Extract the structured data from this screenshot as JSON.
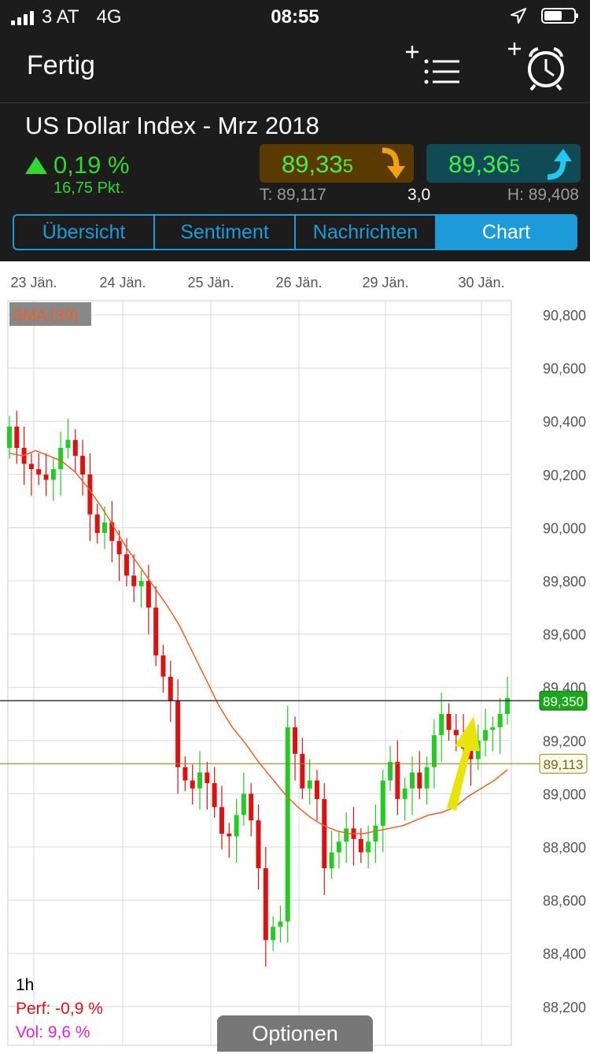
{
  "status_bar": {
    "carrier": "3 AT",
    "network": "4G",
    "time": "08:55"
  },
  "nav": {
    "done_label": "Fertig",
    "add_watchlist_icon": "plus-list-icon",
    "add_alarm_icon": "plus-alarm-icon"
  },
  "instrument": {
    "name": "US Dollar Index - Mrz 2018",
    "change_pct": "0,19 %",
    "change_points": "16,75 Pkt.",
    "bid_main": "89,33",
    "bid_small": "5",
    "ask_main": "89,36",
    "ask_small": "5",
    "low": "T: 89,117",
    "spread": "3,0",
    "high": "H: 89,408"
  },
  "tabs": [
    {
      "label": "Übersicht",
      "active": false
    },
    {
      "label": "Sentiment",
      "active": false
    },
    {
      "label": "Nachrichten",
      "active": false
    },
    {
      "label": "Chart",
      "active": true
    }
  ],
  "chart": {
    "indicator_label": "SMA (39)",
    "interval": "1h",
    "perf": "Perf: -0,9 %",
    "vol": "Vol: 9,6 %",
    "current_price_label": "89,350",
    "low_line_label": "89,113",
    "options_label": "Optionen"
  },
  "colors": {
    "up": "#22cc22",
    "down": "#dd1111",
    "sma": "#f06020",
    "accent": "#1c9bd8",
    "bid_box": "#5a3a00",
    "ask_box": "#0f4a55"
  },
  "chart_data": {
    "type": "candlestick",
    "x_ticks": [
      "23 Jän.",
      "24 Jän.",
      "25 Jän.",
      "26 Jän.",
      "29 Jän.",
      "30 Jän."
    ],
    "y_ticks": [
      "90,800",
      "90,600",
      "90,400",
      "90,200",
      "90,000",
      "89,800",
      "89,600",
      "89,400",
      "89,200",
      "89,000",
      "88,800",
      "88,600",
      "88,400",
      "88,200"
    ],
    "ylim": [
      88.15,
      90.85
    ],
    "current_price": 89.35,
    "low_line": 89.113,
    "close_series": [
      90.38,
      90.3,
      90.24,
      90.22,
      90.2,
      90.18,
      90.22,
      90.3,
      90.33,
      90.27,
      90.2,
      90.05,
      89.98,
      90.02,
      89.95,
      89.9,
      89.82,
      89.78,
      89.8,
      89.7,
      89.52,
      89.44,
      89.35,
      89.1,
      89.05,
      89.02,
      89.08,
      89.04,
      88.95,
      88.85,
      88.84,
      88.92,
      89.0,
      88.9,
      88.72,
      88.45,
      88.5,
      88.52,
      89.25,
      89.15,
      89.02,
      89.05,
      88.98,
      88.72,
      88.78,
      88.82,
      88.87,
      88.83,
      88.78,
      88.82,
      88.88,
      89.05,
      89.12,
      88.98,
      89.02,
      89.08,
      89.02,
      89.1,
      89.22,
      89.3,
      89.24,
      89.22,
      89.17,
      89.13,
      89.2,
      89.24,
      89.25,
      89.3,
      89.36
    ],
    "sma_series": [
      90.28,
      90.27,
      90.29,
      90.27,
      90.25,
      90.21,
      90.15,
      90.08,
      90.0,
      89.92,
      89.85,
      89.78,
      89.71,
      89.63,
      89.53,
      89.43,
      89.33,
      89.25,
      89.19,
      89.12,
      89.06,
      89.0,
      88.95,
      88.91,
      88.88,
      88.86,
      88.85,
      88.85,
      88.86,
      88.87,
      88.88,
      88.9,
      88.92,
      88.93,
      88.95,
      88.99,
      89.02,
      89.05,
      89.09
    ]
  }
}
